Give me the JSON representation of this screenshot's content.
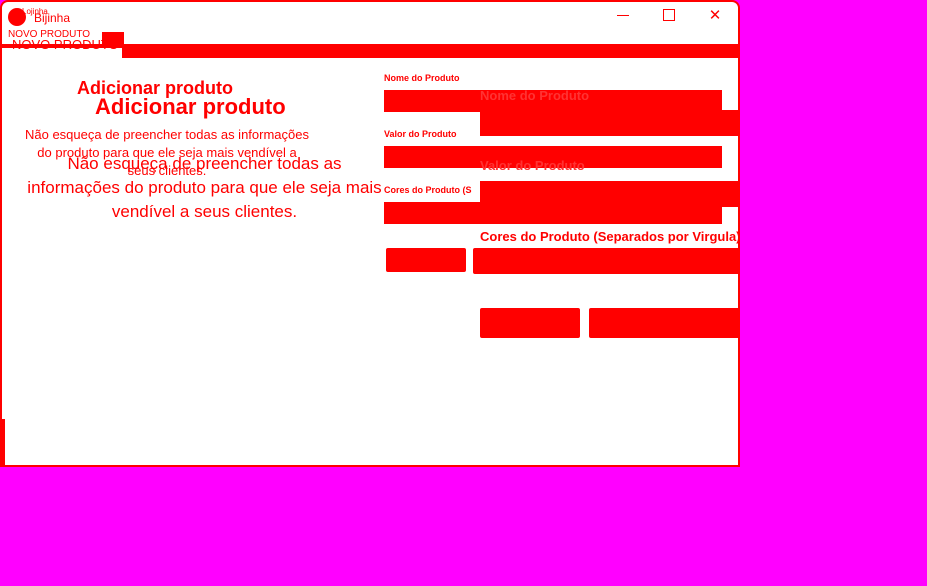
{
  "window": {
    "title_primary": "Bijinha",
    "title_secondary": "Lojinha"
  },
  "menu": {
    "item_primary": "NOVO PRODUTO",
    "item_secondary": "NOVO PRODUTO"
  },
  "heading": {
    "primary": "Adicionar produto",
    "secondary": "Adicionar produto"
  },
  "description": {
    "primary": "Não esqueça de preencher todas as informações do produto para que ele seja mais vendível a seus clientes.",
    "secondary": "Não esqueça de preencher todas as informações do produto para que ele seja mais vendível a seus clientes."
  },
  "form": {
    "name_label": "Nome do Produto",
    "value_label": "Valor do Produto",
    "colors_label": "Cores do Produto (S",
    "name_label_big": "Nome do Produto",
    "value_label_big": "Valor do Produto",
    "colors_label_big": "Cores do Produto (Separados por Virgula)"
  },
  "colors": {
    "accent": "#ff0000",
    "background": "#ff00ff",
    "window": "#ffffff"
  },
  "icons": {
    "app": "app-logo-icon",
    "minimize": "minimize-icon",
    "maximize": "maximize-icon",
    "close": "close-icon"
  }
}
